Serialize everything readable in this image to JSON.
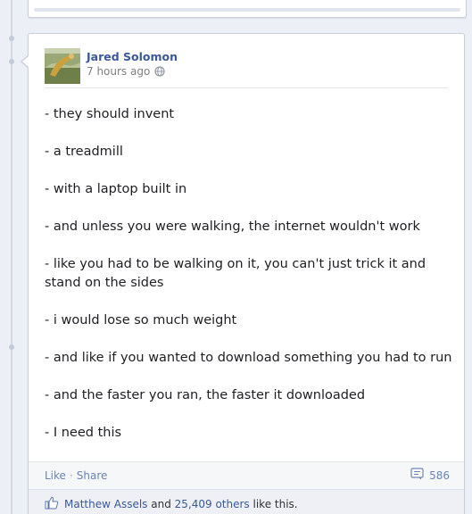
{
  "post": {
    "author": "Jared Solomon",
    "timestamp": "7 hours ago",
    "privacy_icon": "globe-icon",
    "lines": [
      "- they should invent",
      "- a treadmill",
      "- with a laptop built in",
      "- and unless you were walking, the internet wouldn't work",
      "- like you had to be walking on it, you can't just trick it and stand on the sides",
      "- i would lose so much weight",
      "- and like if you wanted to download something you had to run",
      "- and the faster you ran, the faster it downloaded",
      "- I need this"
    ]
  },
  "actions": {
    "like": "Like",
    "separator": "·",
    "share": "Share",
    "comment_count": "586",
    "comment_icon": "comment-icon"
  },
  "likes": {
    "icon": "thumbs-up-icon",
    "name": "Matthew Assels",
    "connector": "and",
    "others": "25,409 others",
    "suffix": "like this."
  },
  "colors": {
    "link": "#3b5998",
    "background": "#eceff5"
  }
}
